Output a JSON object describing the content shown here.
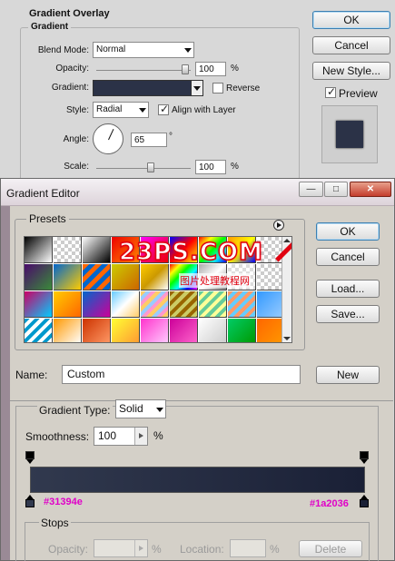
{
  "layer_style": {
    "section_title": "Gradient Overlay",
    "group_title": "Gradient",
    "blend_mode_label": "Blend Mode:",
    "blend_mode_value": "Normal",
    "opacity_label": "Opacity:",
    "opacity_value": "100",
    "opacity_unit": "%",
    "opacity_level": 1.0,
    "gradient_label": "Gradient:",
    "reverse_label": "Reverse",
    "reverse_checked": false,
    "style_label": "Style:",
    "style_value": "Radial",
    "align_label": "Align with Layer",
    "align_checked": true,
    "angle_label": "Angle:",
    "angle_value": "65",
    "angle_unit": "°",
    "scale_label": "Scale:",
    "scale_value": "100",
    "scale_unit": "%",
    "scale_level": 0.5,
    "ok_label": "OK",
    "cancel_label": "Cancel",
    "new_style_label": "New Style...",
    "preview_label": "Preview",
    "preview_checked": true,
    "preview_color": "#2b3247"
  },
  "gradient_editor": {
    "title": "Gradient Editor",
    "presets_label": "Presets",
    "ok_label": "OK",
    "cancel_label": "Cancel",
    "load_label": "Load...",
    "save_label": "Save...",
    "name_label": "Name:",
    "name_value": "Custom",
    "new_label": "New",
    "gradient_type_label": "Gradient Type:",
    "gradient_type_value": "Solid",
    "smoothness_label": "Smoothness:",
    "smoothness_value": "100",
    "smoothness_unit": "%",
    "stop_left_color_text": "#31394e",
    "stop_right_color_text": "#1a2036",
    "color_left": "#31394e",
    "color_right": "#1a2036",
    "stops_label": "Stops",
    "stops_opacity_label": "Opacity:",
    "stops_opacity_unit": "%",
    "stops_location_label": "Location:",
    "stops_location_unit": "%",
    "delete_label": "Delete"
  },
  "watermark": {
    "text": "23PS.COM",
    "subtext": "图片处理教程网"
  }
}
